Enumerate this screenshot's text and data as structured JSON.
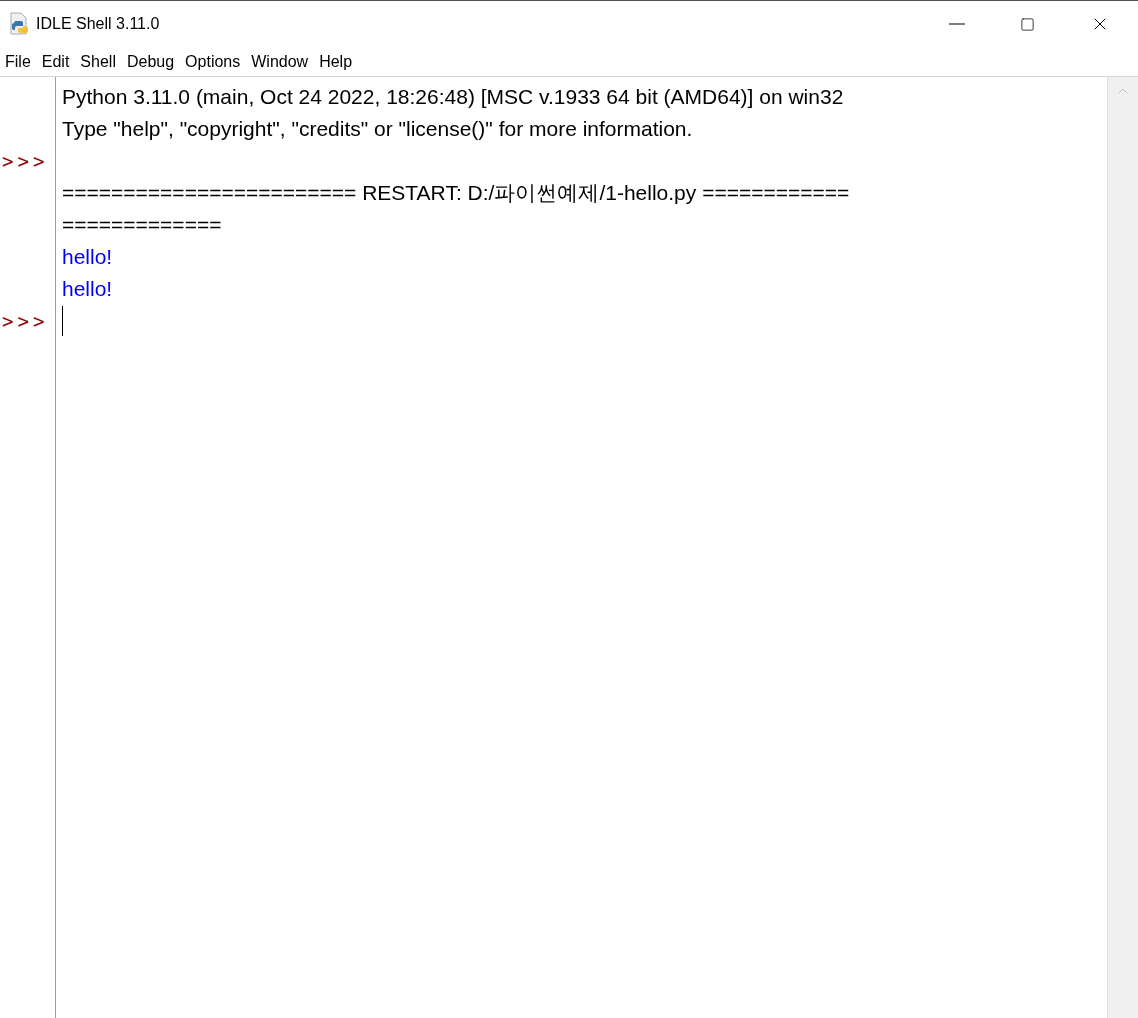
{
  "window": {
    "title": "IDLE Shell 3.11.0"
  },
  "menu": [
    "File",
    "Edit",
    "Shell",
    "Debug",
    "Options",
    "Window",
    "Help"
  ],
  "shell": {
    "lines": [
      {
        "kind": "output",
        "text": "Python 3.11.0 (main, Oct 24 2022, 18:26:48) [MSC v.1933 64 bit (AMD64)] on win32"
      },
      {
        "kind": "output",
        "text": "Type \"help\", \"copyright\", \"credits\" or \"license()\" for more information."
      },
      {
        "kind": "prompt",
        "prompt": ">>>"
      },
      {
        "kind": "output",
        "text": "======================== RESTART: D:/파이썬예제/1-hello.py ============"
      },
      {
        "kind": "output",
        "text": "============="
      },
      {
        "kind": "stdout",
        "text": "hello!"
      },
      {
        "kind": "stdout",
        "text": "hello!"
      },
      {
        "kind": "input",
        "prompt": ">>>"
      }
    ]
  }
}
